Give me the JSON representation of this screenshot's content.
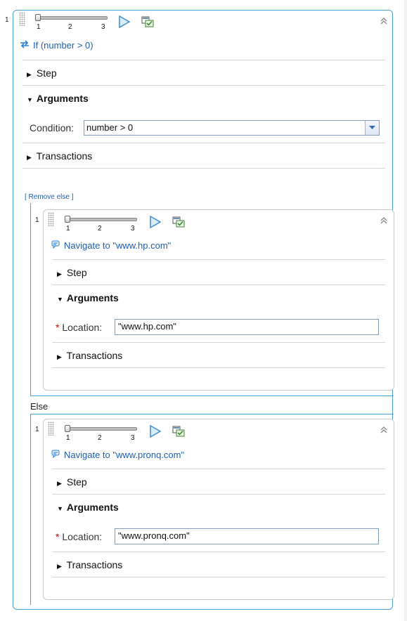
{
  "outer": {
    "step_number": "1",
    "slider_ticks": [
      "1",
      "2",
      "3"
    ],
    "description": "If (number > 0)",
    "sections": {
      "step": "Step",
      "arguments": "Arguments",
      "transactions": "Transactions"
    },
    "condition_label": "Condition:",
    "condition_value": "number > 0",
    "remove_else_link": "[ Remove else ]"
  },
  "inner_if": {
    "step_number": "1",
    "slider_ticks": [
      "1",
      "2",
      "3"
    ],
    "description": "Navigate to \"www.hp.com\"",
    "sections": {
      "step": "Step",
      "arguments": "Arguments",
      "transactions": "Transactions"
    },
    "required_mark": "*",
    "location_label": "Location:",
    "location_value": "\"www.hp.com\""
  },
  "else_label": "Else",
  "inner_else": {
    "step_number": "1",
    "slider_ticks": [
      "1",
      "2",
      "3"
    ],
    "description": "Navigate to \"www.pronq.com\"",
    "sections": {
      "step": "Step",
      "arguments": "Arguments",
      "transactions": "Transactions"
    },
    "required_mark": "*",
    "location_label": "Location:",
    "location_value": "\"www.pronq.com\""
  },
  "icons": {
    "play": "play-triangle-icon",
    "snapshot": "snapshot-icon",
    "collapse": "double-chevron-up-icon",
    "if": "if-arrows-icon",
    "navigate": "navigate-speech-icon",
    "expanded": "triangle-down-icon",
    "collapsed": "triangle-right-icon"
  },
  "colors": {
    "accent": "#4a9fd8",
    "link": "#1f5fb0",
    "required": "#cc0000"
  }
}
